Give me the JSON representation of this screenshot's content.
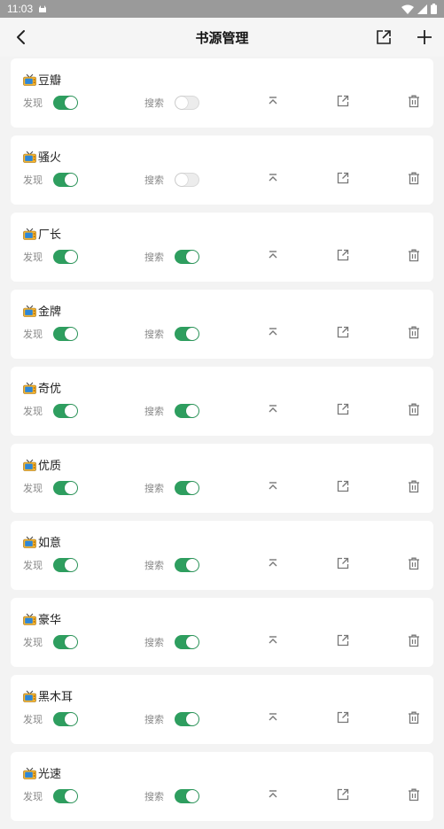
{
  "status": {
    "time": "11:03"
  },
  "appbar": {
    "title": "书源管理",
    "back_icon": "chevron-left-icon",
    "share_icon": "share-icon",
    "add_icon": "plus-icon"
  },
  "labels": {
    "discover": "发现",
    "search": "搜索"
  },
  "colors": {
    "accent": "#2e9e5f"
  },
  "sources": [
    {
      "name": "豆瓣",
      "discover": true,
      "search": false
    },
    {
      "name": "骚火",
      "discover": true,
      "search": false
    },
    {
      "name": "厂长",
      "discover": true,
      "search": true
    },
    {
      "name": "金牌",
      "discover": true,
      "search": true
    },
    {
      "name": "奇优",
      "discover": true,
      "search": true
    },
    {
      "name": "优质",
      "discover": true,
      "search": true
    },
    {
      "name": "如意",
      "discover": true,
      "search": true
    },
    {
      "name": "豪华",
      "discover": true,
      "search": true
    },
    {
      "name": "黑木耳",
      "discover": true,
      "search": true
    },
    {
      "name": "光速",
      "discover": true,
      "search": true
    }
  ]
}
